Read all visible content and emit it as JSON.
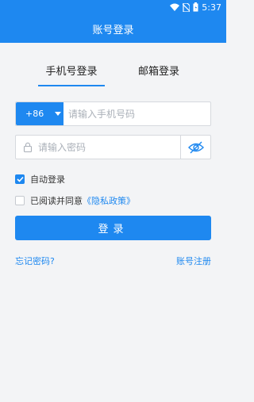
{
  "status": {
    "time": "5:37"
  },
  "header": {
    "title": "账号登录"
  },
  "tabs": [
    {
      "label": "手机号登录",
      "active": true
    },
    {
      "label": "邮箱登录",
      "active": false
    }
  ],
  "phone": {
    "country_code": "+86",
    "placeholder": "请输入手机号码",
    "value": ""
  },
  "password": {
    "placeholder": "请输入密码",
    "value": ""
  },
  "options": {
    "auto_login": {
      "label": "自动登录",
      "checked": true
    },
    "agreement": {
      "label": "已阅读并同意",
      "link": "《隐私政策》",
      "checked": false
    }
  },
  "login_button": {
    "label": "登录"
  },
  "links": {
    "forgot_password": "忘记密码?",
    "register": "账号注册"
  },
  "colors": {
    "accent": "#1e88f0",
    "background": "#f3f4f6"
  }
}
